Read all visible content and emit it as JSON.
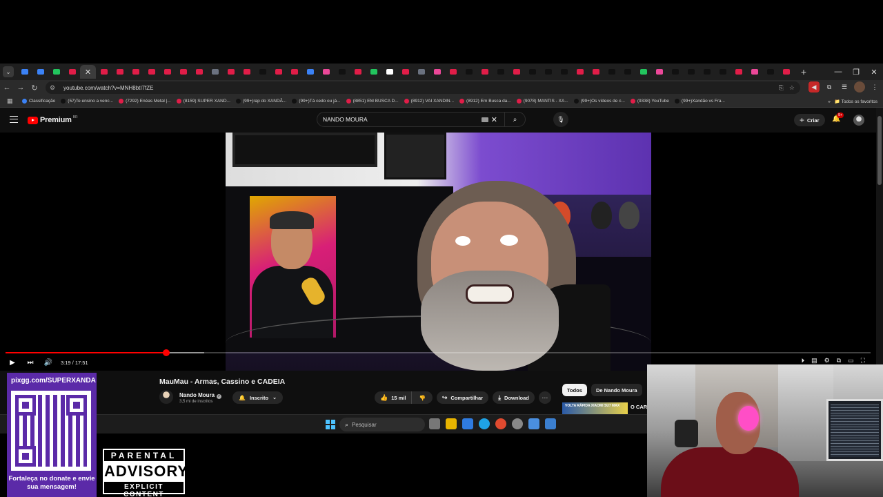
{
  "browser": {
    "url": "youtube.com/watch?v=MNH8btI7fZE",
    "tab_favicon_colors": [
      "#3b82f6",
      "#3b82f6",
      "#22c55e",
      "#e11d48",
      "#e11d48",
      "#e11d48",
      "#e11d48",
      "#e11d48",
      "#e11d48",
      "#e11d48",
      "#e11d48",
      "#e11d48",
      "#6b7280",
      "#e11d48",
      "#e11d48",
      "#111111",
      "#e11d48",
      "#e11d48",
      "#3b82f6",
      "#ec4899",
      "#111111",
      "#e11d48",
      "#22c55e",
      "#ffffff",
      "#e11d48",
      "#6b7280",
      "#ec4899",
      "#e11d48",
      "#111111",
      "#e11d48",
      "#111111",
      "#e11d48",
      "#111111",
      "#111111",
      "#111111",
      "#e11d48",
      "#e11d48",
      "#111111",
      "#111111",
      "#22c55e",
      "#ec4899",
      "#111111",
      "#111111",
      "#111111",
      "#111111",
      "#e11d48",
      "#ec4899",
      "#111111",
      "#e11d48"
    ],
    "bookmarks": [
      {
        "label": "Classificação",
        "color": "#3b82f6"
      },
      {
        "label": "(57)Te ensino a venc...",
        "color": "#111111"
      },
      {
        "label": "(7292) Enéas Metal |...",
        "color": "#e11d48"
      },
      {
        "label": "(8159) SUPER XAND...",
        "color": "#e11d48"
      },
      {
        "label": "(99+)rap do XANDÃ...",
        "color": "#111111"
      },
      {
        "label": "(99+)Tá cedo ou já...",
        "color": "#111111"
      },
      {
        "label": "(8851) EM BUSCA D...",
        "color": "#e11d48"
      },
      {
        "label": "(8912) VAI XANDIN...",
        "color": "#e11d48"
      },
      {
        "label": "(8912) Em Busca da...",
        "color": "#e11d48"
      },
      {
        "label": "(9078) MANTIS - XA...",
        "color": "#e11d48"
      },
      {
        "label": "(99+)Os vídeos de c...",
        "color": "#111111"
      },
      {
        "label": "(9338) YouTube",
        "color": "#e11d48"
      },
      {
        "label": "(99+)Xandão vs Fra...",
        "color": "#111111"
      }
    ],
    "all_bookmarks_label": "Todos os favoritos"
  },
  "youtube": {
    "logo_text": "Premium",
    "logo_region": "BR",
    "search_value": "NANDO MOURA",
    "create_label": "Criar",
    "notifications_badge": "9+"
  },
  "player": {
    "time": "3:19 / 17:51",
    "progress_fraction": 0.186,
    "buffer_fraction": 0.23
  },
  "video": {
    "title": "MauMau - Armas, Cassino e CADEIA",
    "channel_name": "Nando Moura",
    "subscribers": "3,5 mi de inscritos",
    "subscribed_label": "Inscrito",
    "likes": "15 mil",
    "share_label": "Compartilhar",
    "download_label": "Download"
  },
  "sidebar": {
    "chips": [
      "Todos",
      "De Nando Moura"
    ],
    "rec_thumb_text": "VOLTA RÁPIDA XIAOMI SU7 MAX",
    "rec_title": "O CARR CHINÊ"
  },
  "taskbar": {
    "search_placeholder": "Pesquisar",
    "app_colors": [
      "#777777",
      "#e8b400",
      "#2f7be0",
      "#1fa3e6",
      "#e04a2f",
      "#888888",
      "#4a8fe0",
      "#3b7fd0"
    ]
  },
  "overlay": {
    "pix_link": "pixgg.com/SUPERXANDA",
    "donate_message": "Fortaleça no donate e envie sua mensagem!",
    "advisory_top": "PARENTAL",
    "advisory_mid": "ADVISORY",
    "advisory_bottom": "EXPLICIT CONTENT"
  }
}
